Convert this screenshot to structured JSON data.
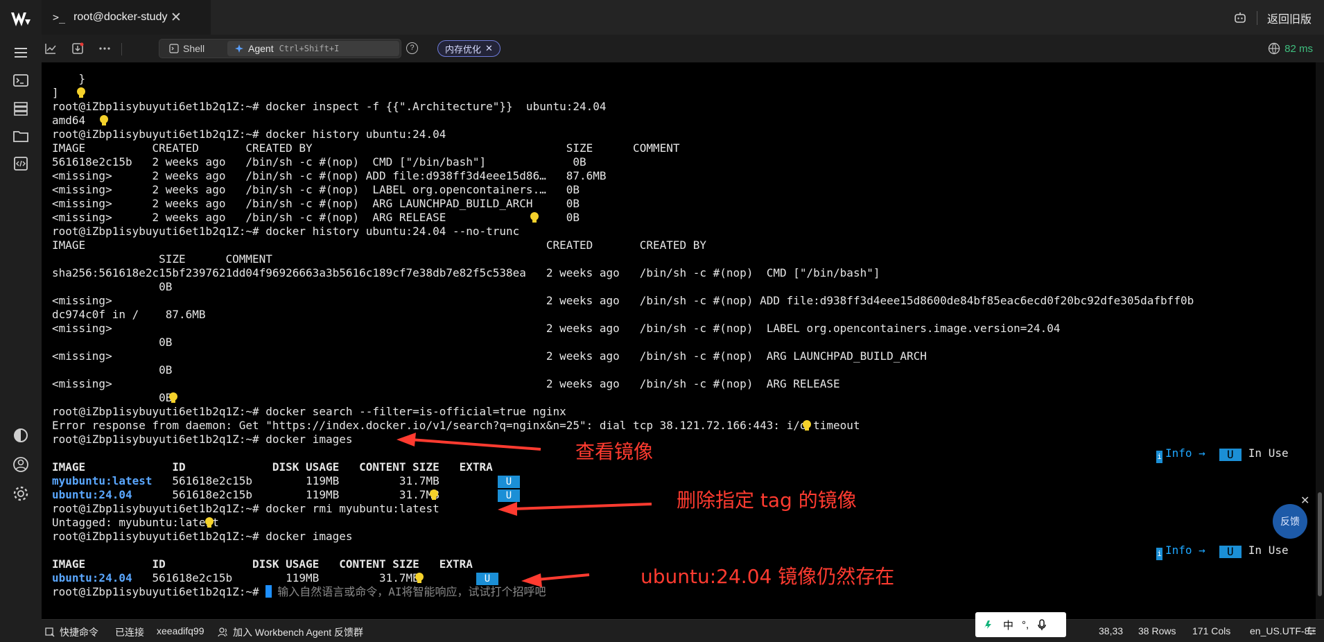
{
  "titlebar": {
    "tab_icon": ">_",
    "tab_title": "root@docker-study",
    "tab_close": "✕",
    "back_label": "返回旧版"
  },
  "toolbar": {
    "shell_label": "Shell",
    "agent_label": "Agent",
    "agent_shortcut": "Ctrl+Shift+I",
    "help_label": "?",
    "memory_chip": "内存优化",
    "memory_chip_close": "✕",
    "latency": "82 ms"
  },
  "terminal": {
    "lines": [
      "    }",
      "]",
      "root@iZbp1isybuyuti6et1b2q1Z:~# docker inspect -f {{\".Architecture\"}}  ubuntu:24.04",
      "amd64",
      "root@iZbp1isybuyuti6et1b2q1Z:~# docker history ubuntu:24.04",
      "IMAGE          CREATED       CREATED BY                                      SIZE      COMMENT",
      "561618e2c15b   2 weeks ago   /bin/sh -c #(nop)  CMD [\"/bin/bash\"]             0B",
      "<missing>      2 weeks ago   /bin/sh -c #(nop) ADD file:d938ff3d4eee15d86…   87.6MB",
      "<missing>      2 weeks ago   /bin/sh -c #(nop)  LABEL org.opencontainers.…   0B",
      "<missing>      2 weeks ago   /bin/sh -c #(nop)  ARG LAUNCHPAD_BUILD_ARCH     0B",
      "<missing>      2 weeks ago   /bin/sh -c #(nop)  ARG RELEASE                  0B",
      "root@iZbp1isybuyuti6et1b2q1Z:~# docker history ubuntu:24.04 --no-trunc",
      "IMAGE                                                                     CREATED       CREATED BY",
      "                SIZE      COMMENT",
      "sha256:561618e2c15bf2397621dd04f96926663a3b5616c189cf7e38db7e82f5c538ea   2 weeks ago   /bin/sh -c #(nop)  CMD [\"/bin/bash\"]",
      "                0B",
      "<missing>                                                                 2 weeks ago   /bin/sh -c #(nop) ADD file:d938ff3d4eee15d8600de84bf85eac6ecd0f20bc92dfe305dafbff0b",
      "dc974c0f in /    87.6MB",
      "<missing>                                                                 2 weeks ago   /bin/sh -c #(nop)  LABEL org.opencontainers.image.version=24.04",
      "                0B",
      "<missing>                                                                 2 weeks ago   /bin/sh -c #(nop)  ARG LAUNCHPAD_BUILD_ARCH",
      "                0B",
      "<missing>                                                                 2 weeks ago   /bin/sh -c #(nop)  ARG RELEASE",
      "                0B",
      "root@iZbp1isybuyuti6et1b2q1Z:~# docker search --filter=is-official=true nginx",
      "Error response from daemon: Get \"https://index.docker.io/v1/search?q=nginx&n=25\": dial tcp 38.121.72.166:443: i/o timeout",
      "root@iZbp1isybuyuti6et1b2q1Z:~# docker images",
      "",
      "IMAGE             ID             DISK USAGE   CONTENT SIZE   EXTRA",
      "myubuntu:latest   561618e2c15b        119MB         31.7MB",
      "ubuntu:24.04      561618e2c15b        119MB         31.7MB",
      "root@iZbp1isybuyuti6et1b2q1Z:~# docker rmi myubuntu:latest",
      "Untagged: myubuntu:latest",
      "root@iZbp1isybuyuti6et1b2q1Z:~# docker images",
      "",
      "IMAGE          ID             DISK USAGE   CONTENT SIZE   EXTRA",
      "ubuntu:24.04   561618e2c15b        119MB         31.7MB",
      "root@iZbp1isybuyuti6et1b2q1Z:~# "
    ],
    "input_placeholder": "输入自然语言或命令，AI将智能响应，试试打个招呼吧",
    "badge_u": "U",
    "legend": {
      "i_marker": "i",
      "info": "Info →",
      "u": "U",
      "in_use": "In Use"
    }
  },
  "annotations": {
    "view_images": "查看镜像",
    "remove_tag": "删除指定 tag 的镜像",
    "still_exists": "ubuntu:24.04 镜像仍然存在",
    "arrow_color": "#ff3b30"
  },
  "feedback": {
    "label": "反馈",
    "close": "✕"
  },
  "statusbar": {
    "quick_commands": "快捷命令",
    "connected": "已连接",
    "user": "xeeadifq99",
    "join_group": "加入 Workbench Agent 反馈群",
    "ime_char": "中",
    "ime_punct": "°,",
    "cursor_pos": "38,33",
    "rows": "38 Rows",
    "cols": "171 Cols",
    "encoding": "en_US.UTF-8"
  }
}
